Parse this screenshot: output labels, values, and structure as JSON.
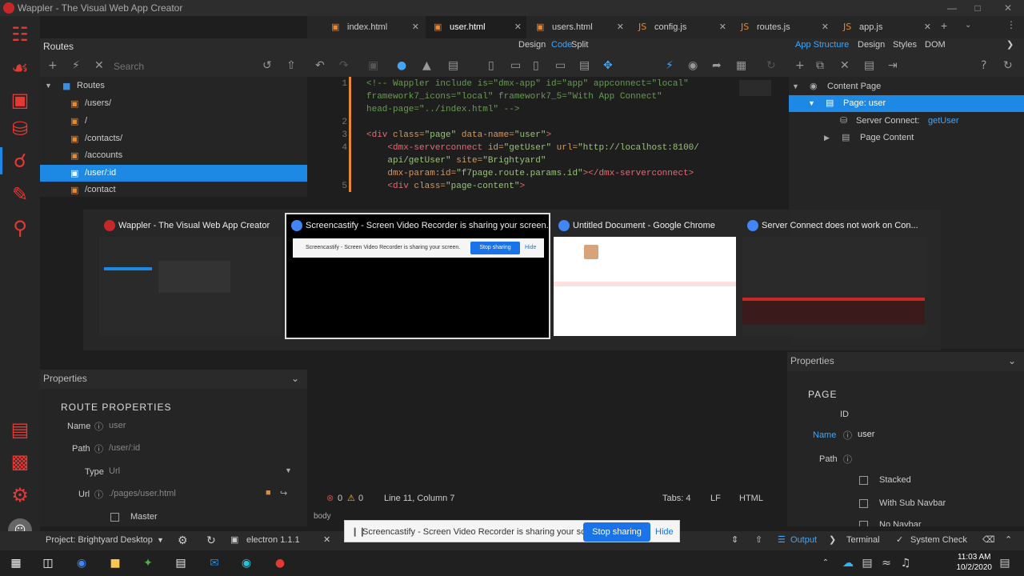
{
  "window": {
    "title": "Wappler - The Visual Web App Creator"
  },
  "tabs": [
    {
      "label": "index.html"
    },
    {
      "label": "user.html"
    },
    {
      "label": "users.html"
    },
    {
      "label": "config.js"
    },
    {
      "label": "routes.js"
    },
    {
      "label": "app.js"
    }
  ],
  "routes_panel": {
    "title": "Routes",
    "search_placeholder": "Search"
  },
  "modes": {
    "design": "Design",
    "code": "Code",
    "split": "Split",
    "app_structure": "App Structure",
    "design2": "Design",
    "styles": "Styles",
    "dom": "DOM"
  },
  "tree": {
    "root": "Routes",
    "items": [
      "/users/",
      "/",
      "/contacts/",
      "/accounts",
      "/user/:id",
      "/contact"
    ]
  },
  "code_lines": [
    {
      "n": "1",
      "parts": [
        [
          "cm",
          "<!-- Wappler include is=\"dmx-app\" id=\"app\" appconnect=\"local\""
        ]
      ]
    },
    {
      "n": "",
      "parts": [
        [
          "cm",
          "framework7_icons=\"local\" framework7_5=\"With App Connect\""
        ]
      ]
    },
    {
      "n": "",
      "parts": [
        [
          "cm",
          "head-page=\"../index.html\" -->"
        ]
      ]
    },
    {
      "n": "2",
      "parts": [
        [
          "pl",
          ""
        ]
      ]
    },
    {
      "n": "3",
      "parts": [
        [
          "tg",
          "<div "
        ],
        [
          "at",
          "class="
        ],
        [
          "st",
          "\"page\" "
        ],
        [
          "at",
          "data-name="
        ],
        [
          "st",
          "\"user\""
        ],
        [
          "tg",
          ">"
        ]
      ]
    },
    {
      "n": "4",
      "parts": [
        [
          "tg",
          "    <dmx-serverconnect "
        ],
        [
          "at",
          "id="
        ],
        [
          "st",
          "\"getUser\" "
        ],
        [
          "at",
          "url="
        ],
        [
          "st",
          "\"http://localhost:8100/"
        ]
      ]
    },
    {
      "n": "",
      "parts": [
        [
          "st",
          "    api/getUser\" "
        ],
        [
          "at",
          "site="
        ],
        [
          "st",
          "\"Brightyard\""
        ]
      ]
    },
    {
      "n": "",
      "parts": [
        [
          "at",
          "    dmx-param:id="
        ],
        [
          "st",
          "\"f7page.route.params.id\""
        ],
        [
          "tg",
          "></dmx-serverconnect>"
        ]
      ]
    },
    {
      "n": "5",
      "parts": [
        [
          "tg",
          "    <div "
        ],
        [
          "at",
          "class="
        ],
        [
          "st",
          "\"page-content\""
        ],
        [
          "tg",
          ">"
        ]
      ]
    }
  ],
  "structure": {
    "content_page": "Content Page",
    "page_user": "Page: user",
    "server_connect_label": "Server Connect:",
    "server_connect_value": "getUser",
    "page_content": "Page Content"
  },
  "switcher": [
    {
      "title": "Wappler - The Visual Web App Creator",
      "color": "#c62828"
    },
    {
      "title": "Screencastify - Screen Video Recorder is sharing your screen.",
      "color": "#4285f4",
      "stop": "Stop sharing",
      "hide": "Hide",
      "msg": "Screencastify - Screen Video Recorder is sharing your screen."
    },
    {
      "title": "Untitled Document - Google Chrome",
      "color": "#4285f4"
    },
    {
      "title": "Server Connect does not work on Con...",
      "color": "#4285f4"
    }
  ],
  "props_left": {
    "header": "Properties",
    "section": "ROUTE PROPERTIES",
    "name_label": "Name",
    "name_value": "user",
    "path_label": "Path",
    "path_value": "/user/:id",
    "type_label": "Type",
    "type_value": "Url",
    "url_label": "Url",
    "url_value": "./pages/user.html",
    "master_label": "Master"
  },
  "props_right": {
    "header": "Properties",
    "section": "PAGE",
    "id_label": "ID",
    "name_label": "Name",
    "name_value": "user",
    "path_label": "Path",
    "stacked": "Stacked",
    "sub_navbar": "With Sub Navbar",
    "no_navbar": "No Navbar"
  },
  "status": {
    "errors": "0",
    "warnings": "0",
    "position": "Line 11, Column 7",
    "tabs": "Tabs: 4",
    "eol": "LF",
    "lang": "HTML",
    "crumb": "body"
  },
  "bottom": {
    "project": "Project: Brightyard Desktop",
    "electron": "electron 1.1.1",
    "output": "Output",
    "terminal": "Terminal",
    "system_check": "System Check"
  },
  "notify": {
    "text": "Screencastify - Screen Video Recorder is sharing your screen.",
    "stop": "Stop sharing",
    "hide": "Hide"
  },
  "clock": {
    "time": "11:03 AM",
    "date": "10/2/2020"
  }
}
